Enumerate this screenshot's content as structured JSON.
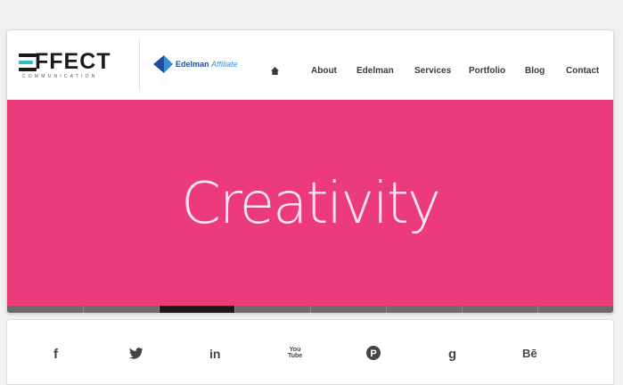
{
  "brand": {
    "logo_word": "FFECT",
    "logo_sub": "COMMUNICATION",
    "bar_colors": [
      "#1a1a1a",
      "#3ab7c4"
    ],
    "affiliate_strong": "Edelman",
    "affiliate_light": "Affiliate"
  },
  "nav": {
    "home_icon": "home-icon",
    "items": [
      {
        "label": "About"
      },
      {
        "label": "Edelman"
      },
      {
        "label": "Services"
      },
      {
        "label": "Portfolio"
      },
      {
        "label": "Blog"
      },
      {
        "label": "Contact"
      }
    ]
  },
  "hero": {
    "text": "Creativity",
    "background": "#ec3b7a",
    "slide_count": 8,
    "active_slide": 3
  },
  "social": {
    "icons": [
      {
        "name": "facebook-icon",
        "glyph": "f"
      },
      {
        "name": "twitter-icon",
        "glyph": ""
      },
      {
        "name": "linkedin-icon",
        "glyph": "in"
      },
      {
        "name": "youtube-icon",
        "glyph": "You Tube"
      },
      {
        "name": "pinterest-icon",
        "glyph": "P"
      },
      {
        "name": "google-icon",
        "glyph": "g"
      },
      {
        "name": "behance-icon",
        "glyph": "Bē"
      }
    ]
  }
}
